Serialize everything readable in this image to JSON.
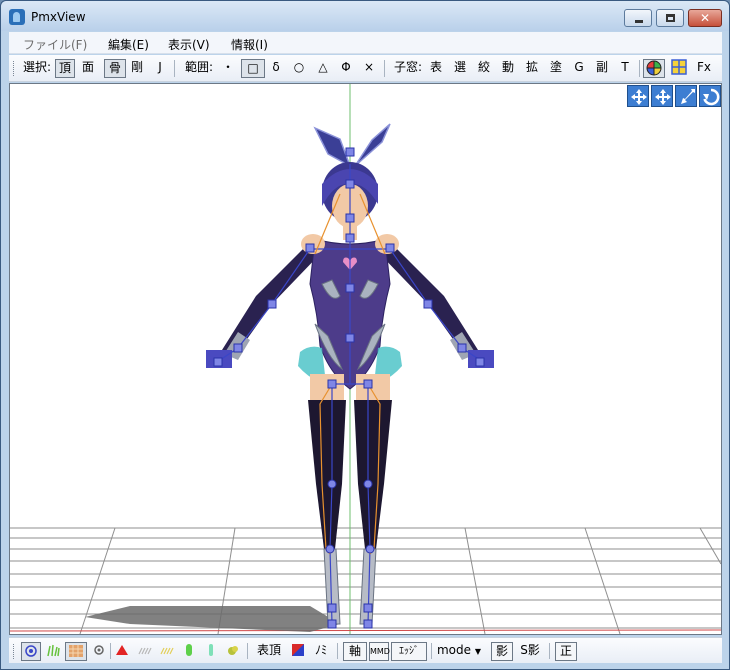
{
  "window": {
    "title": "PmxView"
  },
  "menu": {
    "file": "ファイル(F)",
    "edit": "編集(E)",
    "view": "表示(V)",
    "info": "情報(I)"
  },
  "toolbar": {
    "select_label": "選択:",
    "select_vertex": "頂",
    "select_face": "面",
    "select_bone": "骨",
    "select_rigid": "剛",
    "select_joint": "J",
    "range_label": "範囲:",
    "range_point": "・",
    "range_rect": "□",
    "range_delta": "δ",
    "range_circle": "○",
    "range_triangle": "△",
    "range_phi": "Φ",
    "range_x": "×",
    "subwin_label": "子窓:",
    "subwin_table": "表",
    "subwin_select": "選",
    "subwin_narrow": "絞",
    "subwin_move": "動",
    "subwin_scale": "拡",
    "subwin_paint": "塗",
    "subwin_g": "G",
    "subwin_sub": "副",
    "subwin_t": "T",
    "fx_label": "Fx"
  },
  "statusbar": {
    "vertex_table": "表頂",
    "morph": "ﾉﾐ",
    "axis": "軸",
    "mmd": "MMD",
    "edge": "ｴｯｼﾞ",
    "mode": "mode",
    "shadow": "影",
    "s_shadow": "S影",
    "front": "正"
  },
  "colors": {
    "accent": "#3d7ed2",
    "bone": "#3a46c8",
    "leotard": "#4d3c8a",
    "stocking": "#1d1730",
    "skin": "#f2c9a6",
    "frill": "#4fc4c8"
  }
}
